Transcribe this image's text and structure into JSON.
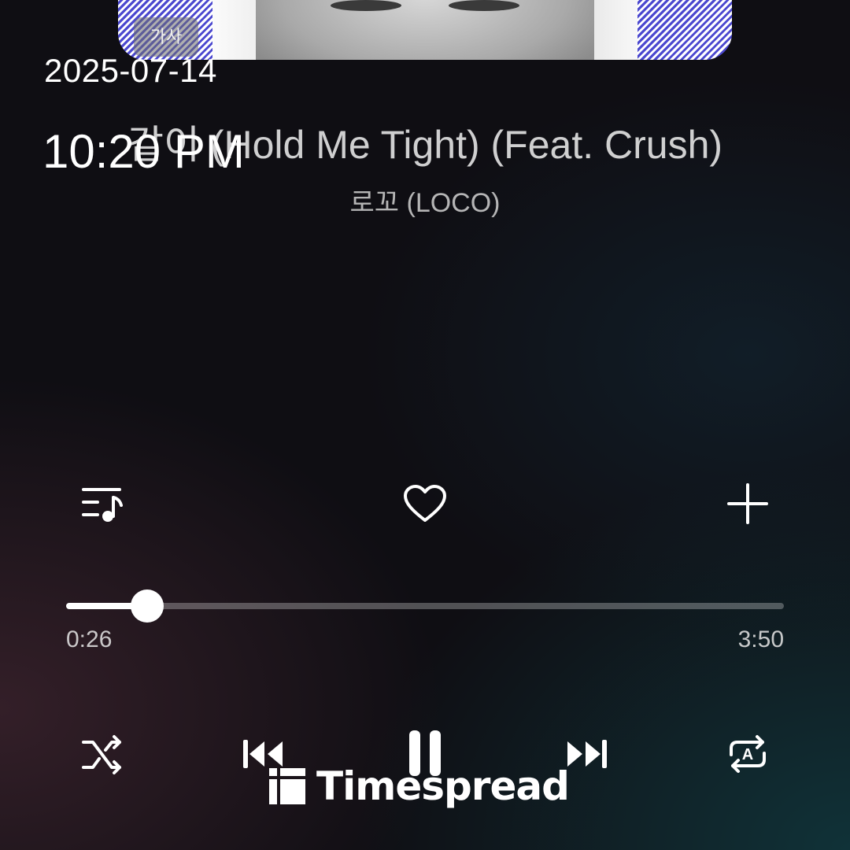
{
  "overlay": {
    "date": "2025-07-14",
    "time": "10:20 PM"
  },
  "album_art": {
    "lyrics_label": "가사"
  },
  "track": {
    "title": "같이 (Hold Me Tight) (Feat. Crush)",
    "artist": "로꼬 (LOCO)"
  },
  "actions": {
    "playlist_icon": "playlist-icon",
    "like_icon": "heart-outline-icon",
    "add_icon": "plus-icon"
  },
  "playback": {
    "elapsed": "0:26",
    "total": "3:50",
    "progress_fraction": 0.113
  },
  "controls": {
    "shuffle_icon": "shuffle-icon",
    "previous_icon": "skip-previous-icon",
    "play_state": "playing",
    "pause_icon": "pause-icon",
    "next_icon": "skip-next-icon",
    "repeat_icon": "repeat-all-icon",
    "repeat_mode_letter": "A"
  },
  "watermark": {
    "text": "Timespread"
  },
  "colors": {
    "accent": "#ffffff",
    "album_blue": "#4b48cf",
    "background": "#0f0e13"
  }
}
